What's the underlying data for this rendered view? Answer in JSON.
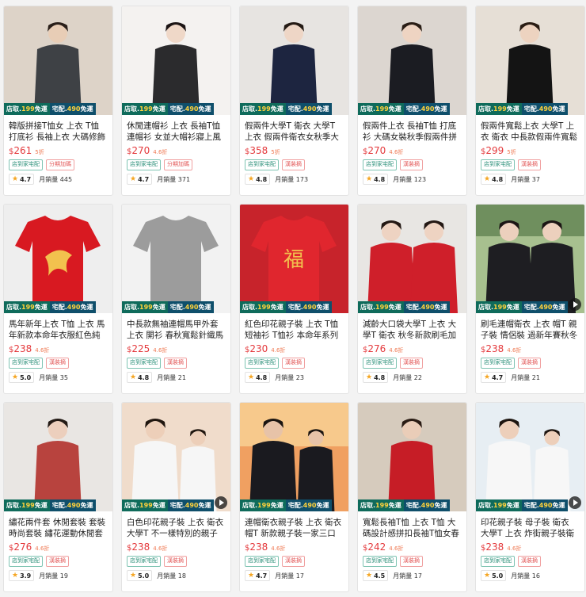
{
  "products": [
    {
      "title": "韓版拼接T恤女 上衣 T恤 打底衫 長袖上衣 大碼修飾",
      "currency": "$",
      "price": "261",
      "discount": "5折",
      "tags": [
        "店到家宅配",
        "分期加碼"
      ],
      "rating": "4.7",
      "sales_label": "月銷量",
      "sales": "445",
      "video": false,
      "scene": "gray-top"
    },
    {
      "title": "休閒連帽衫 上衣 長袖T恤 連帽衫 女並大帽衫寢上風格",
      "currency": "$",
      "price": "270",
      "discount": "4.6折",
      "tags": [
        "店到家宅配",
        "分期加碼"
      ],
      "rating": "4.7",
      "sales_label": "月銷量",
      "sales": "371",
      "video": false,
      "scene": "black-hoodie"
    },
    {
      "title": "假兩件大學T 衛衣 大學T 上衣 假兩件衛衣女秋季大碼長袖",
      "currency": "$",
      "price": "358",
      "discount": "5折",
      "tags": [
        "店到家宅配",
        "漢裝摘"
      ],
      "rating": "4.8",
      "sales_label": "月銷量",
      "sales": "173",
      "video": false,
      "scene": "navy-cardigan"
    },
    {
      "title": "假兩件上衣 長袖T恤 打底衫 大碼女裝秋季假兩件拼接上衣",
      "currency": "$",
      "price": "270",
      "discount": "4.6折",
      "tags": [
        "店到家宅配",
        "漢裝摘"
      ],
      "rating": "4.8",
      "sales_label": "月銷量",
      "sales": "123",
      "video": false,
      "scene": "black-jacket"
    },
    {
      "title": "假兩件寬鬆上衣 大學T 上衣 衛衣 中長款假兩件寬鬆衛衣",
      "currency": "$",
      "price": "299",
      "discount": "5折",
      "tags": [
        "店到家宅配",
        "漢裝摘"
      ],
      "rating": "4.8",
      "sales_label": "月銷量",
      "sales": "37",
      "video": false,
      "scene": "black-long"
    },
    {
      "title": "馬年新年上衣 T恤 上衣 馬年新款本命年衣服紅色純棉",
      "currency": "$",
      "price": "238",
      "discount": "4.6折",
      "tags": [
        "店到家宅配",
        "漢裝摘"
      ],
      "rating": "5.0",
      "sales_label": "月銷量",
      "sales": "35",
      "video": false,
      "scene": "red-horse"
    },
    {
      "title": "中長款無袖連帽馬甲外套 上衣 開衫 春秋寬鬆針織馬甲",
      "currency": "$",
      "price": "225",
      "discount": "4.6折",
      "tags": [
        "店到家宅配",
        "漢裝摘"
      ],
      "rating": "4.8",
      "sales_label": "月銷量",
      "sales": "21",
      "video": false,
      "scene": "gray-vest"
    },
    {
      "title": "紅色印花親子裝 上衣 T恤 短袖衫 T恤衫 本命年系列親子",
      "currency": "$",
      "price": "230",
      "discount": "4.6折",
      "tags": [
        "店到家宅配",
        "漢裝摘"
      ],
      "rating": "4.8",
      "sales_label": "月銷量",
      "sales": "23",
      "video": false,
      "scene": "red-print"
    },
    {
      "title": "減齡大口袋大學T 上衣 大學T 衛衣 秋冬新款刷毛加厚衛衣",
      "currency": "$",
      "price": "276",
      "discount": "4.6折",
      "tags": [
        "店到家宅配",
        "漢裝摘"
      ],
      "rating": "4.8",
      "sales_label": "月銷量",
      "sales": "22",
      "video": false,
      "scene": "red-hoodies"
    },
    {
      "title": "刷毛連帽衛衣 上衣 帽T 親子裝 情侶裝 過新年賽秋冬款",
      "currency": "$",
      "price": "238",
      "discount": "4.6折",
      "tags": [
        "店到家宅配",
        "漢裝摘"
      ],
      "rating": "4.7",
      "sales_label": "月銷量",
      "sales": "21",
      "video": true,
      "scene": "family-black"
    },
    {
      "title": "繡花兩件套 休閒套裝 套裝 時尚套裝 繡花運動休閒套裝",
      "currency": "$",
      "price": "276",
      "discount": "4.6折",
      "tags": [
        "店到家宅配",
        "漢裝摘"
      ],
      "rating": "3.9",
      "sales_label": "月銷量",
      "sales": "19",
      "video": false,
      "scene": "red-set"
    },
    {
      "title": "白色印花親子裝 上衣 衛衣 大學T 不一樣特別的親子裝",
      "currency": "$",
      "price": "238",
      "discount": "4.6折",
      "tags": [
        "店到家宅配",
        "漢裝摘"
      ],
      "rating": "5.0",
      "sales_label": "月銷量",
      "sales": "18",
      "video": true,
      "scene": "white-family"
    },
    {
      "title": "連帽衛衣親子裝 上衣 衛衣 帽T 新款親子裝一家三口秋冬",
      "currency": "$",
      "price": "238",
      "discount": "4.6折",
      "tags": [
        "店到家宅配",
        "漢裝摘"
      ],
      "rating": "4.7",
      "sales_label": "月銷量",
      "sales": "17",
      "video": false,
      "scene": "sunset-family"
    },
    {
      "title": "寬鬆長袖T恤 上衣 T恤 大碼設計感拼扣長袖T恤女春秋",
      "currency": "$",
      "price": "242",
      "discount": "4.6折",
      "tags": [
        "店到家宅配",
        "漢裝摘"
      ],
      "rating": "4.5",
      "sales_label": "月銷量",
      "sales": "17",
      "video": false,
      "scene": "red-tee"
    },
    {
      "title": "印花親子裝 母子裝 衛衣 大學T 上衣 炸街親子裝衛衣秋冬",
      "currency": "$",
      "price": "238",
      "discount": "4.6折",
      "tags": [
        "店到家宅配",
        "漢裝摘"
      ],
      "rating": "5.0",
      "sales_label": "月銷量",
      "sales": "16",
      "video": true,
      "scene": "white-kids"
    }
  ],
  "badge": {
    "store_prefix": "店取.",
    "store_num": "199",
    "store_suffix": "免運",
    "home_prefix": "宅配.",
    "home_num": "490",
    "home_suffix": "免運"
  },
  "colors": {
    "price": "#e4393c",
    "badge_green": "#0f6b5b",
    "badge_blue": "#0f4f6b",
    "star": "#f5a623"
  }
}
